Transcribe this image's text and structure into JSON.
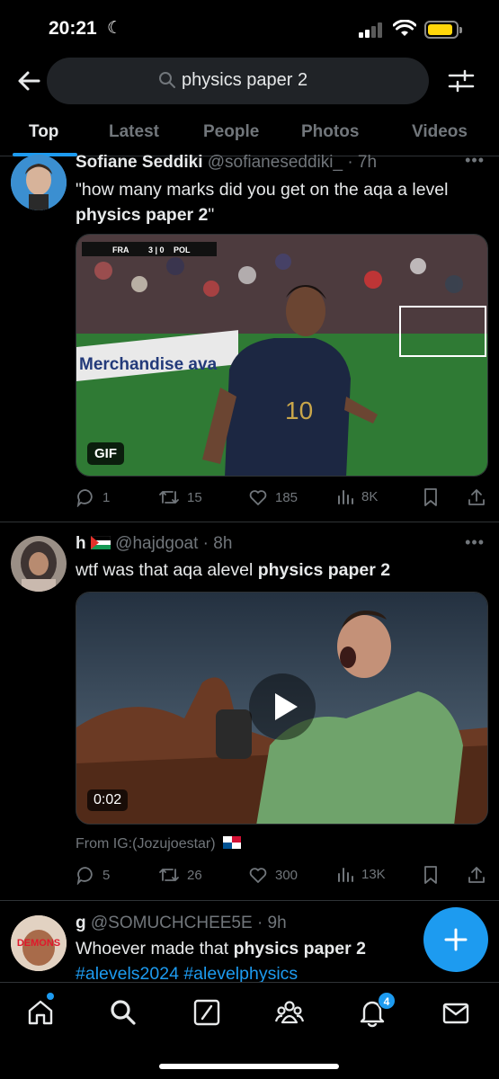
{
  "status_bar": {
    "time": "20:21"
  },
  "search": {
    "query": "physics paper 2"
  },
  "tabs": [
    {
      "label": "Top",
      "active": true
    },
    {
      "label": "Latest",
      "active": false
    },
    {
      "label": "People",
      "active": false
    },
    {
      "label": "Photos",
      "active": false
    },
    {
      "label": "Videos",
      "active": false
    }
  ],
  "tweets": [
    {
      "name": "Sofiane Seddiki",
      "handle": "@sofianeseddiki_",
      "time": "· 7h",
      "text_plain": "\"how many marks did you get on the aqa a level",
      "text_bold": "physics paper 2",
      "text_after": "\"",
      "media": {
        "badge": "GIF",
        "scoreboard": {
          "left": "FRA",
          "score": "3 | 0",
          "right": "POL"
        },
        "ad_text": "Merchandise ava",
        "shirt_number": "10"
      },
      "stats": {
        "replies": "1",
        "retweets": "15",
        "likes": "185",
        "views": "8K"
      }
    },
    {
      "name": "h",
      "handle": "@hajdgoat",
      "time": "· 8h",
      "text_plain": "wtf was that aqa alevel",
      "text_bold": "physics paper 2",
      "media": {
        "duration": "0:02"
      },
      "from": "From IG:(Jozujoestar)",
      "stats": {
        "replies": "5",
        "retweets": "26",
        "likes": "300",
        "views": "13K"
      }
    },
    {
      "name": "g",
      "handle": "@SOMUCHCHEE5E",
      "time": "· 9h",
      "text_plain": "Whoever made that",
      "text_bold": "physics paper 2",
      "hashtags": "#alevels2024 #alevelphysics",
      "avatar_text": "DEMONS"
    }
  ],
  "nav": {
    "notification_count": "4"
  },
  "colors": {
    "accent": "#1d9bf0",
    "background": "#000000",
    "muted": "#71767b"
  }
}
